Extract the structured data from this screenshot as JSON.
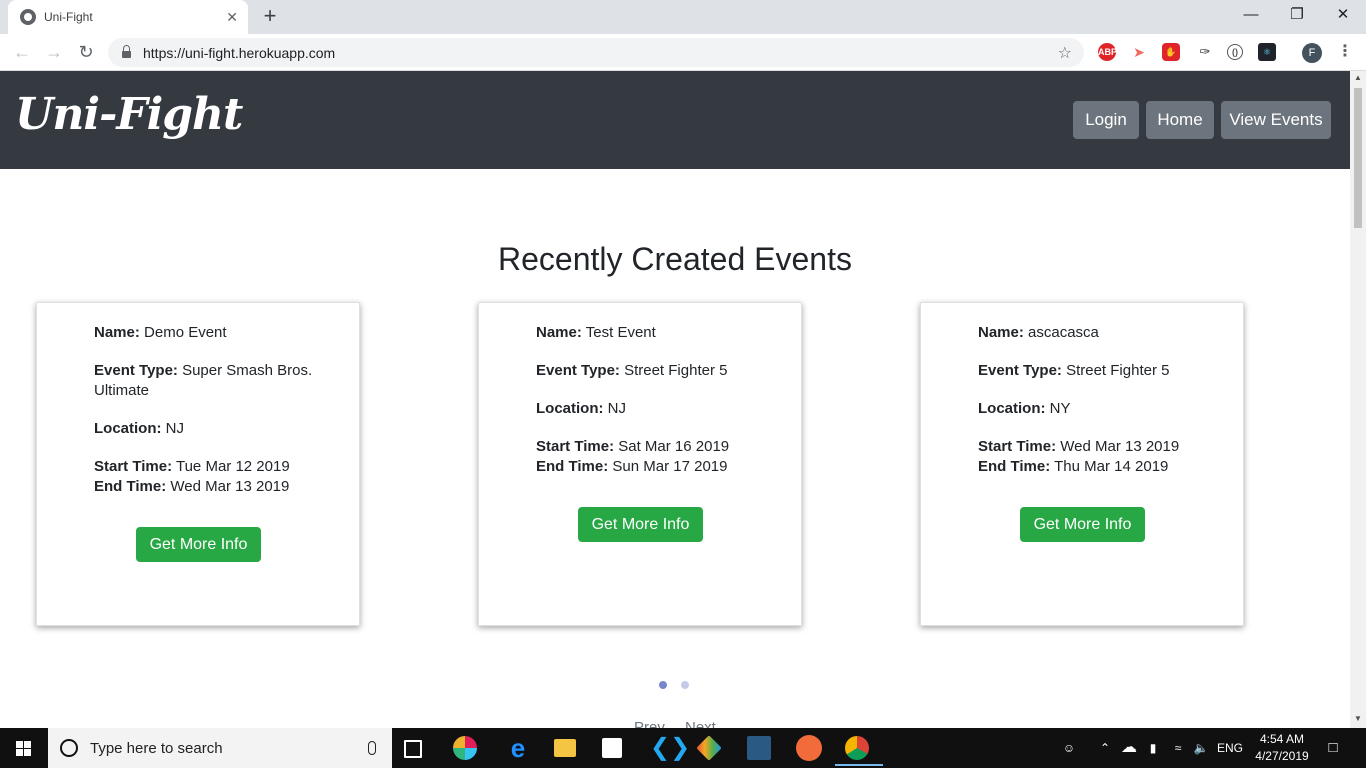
{
  "browser": {
    "tab_title": "Uni-Fight",
    "tab_close": "✕",
    "new_tab": "+",
    "url": "https://uni-fight.herokuapp.com",
    "extensions": [
      "abp-icon",
      "cast-icon",
      "stop-icon",
      "eyedropper-icon",
      "code-icon",
      "react-icon"
    ],
    "profile_initial": "F"
  },
  "site": {
    "brand": "Uni-Fight",
    "nav": [
      "Login",
      "Home",
      "View Events"
    ]
  },
  "main": {
    "heading": "Recently Created Events",
    "labels": {
      "name": "Name:",
      "event_type": "Event Type:",
      "location": "Location:",
      "start_time": "Start Time:",
      "end_time": "End Time:"
    },
    "events": [
      {
        "name": "Demo Event",
        "event_type": "Super Smash Bros. Ultimate",
        "location": "NJ",
        "start_time": "Tue Mar 12 2019",
        "end_time": "Wed Mar 13 2019",
        "button": "Get More Info"
      },
      {
        "name": "Test Event",
        "event_type": "Street Fighter 5",
        "location": "NJ",
        "start_time": "Sat Mar 16 2019",
        "end_time": "Sun Mar 17 2019",
        "button": "Get More Info"
      },
      {
        "name": "ascacasca",
        "event_type": "Street Fighter 5",
        "location": "NY",
        "start_time": "Wed Mar 13 2019",
        "end_time": "Thu Mar 14 2019",
        "button": "Get More Info"
      }
    ],
    "pager": {
      "prev": "Prev",
      "next": "Next"
    },
    "carousel_active_index": 0,
    "colors": {
      "navbar": "#343a40",
      "nav_button": "#6c757d",
      "info_button": "#28a745",
      "dot_active": "#7986cb",
      "dot_inactive": "#c5cae9"
    }
  },
  "taskbar": {
    "search_placeholder": "Type here to search",
    "apps": [
      "task-view-icon",
      "slack-icon",
      "edge-icon",
      "file-explorer-icon",
      "store-icon",
      "vscode-icon",
      "git-icon",
      "mysql-icon",
      "postman-icon",
      "chrome-icon"
    ],
    "language": "ENG",
    "time": "4:54 AM",
    "date": "4/27/2019"
  }
}
